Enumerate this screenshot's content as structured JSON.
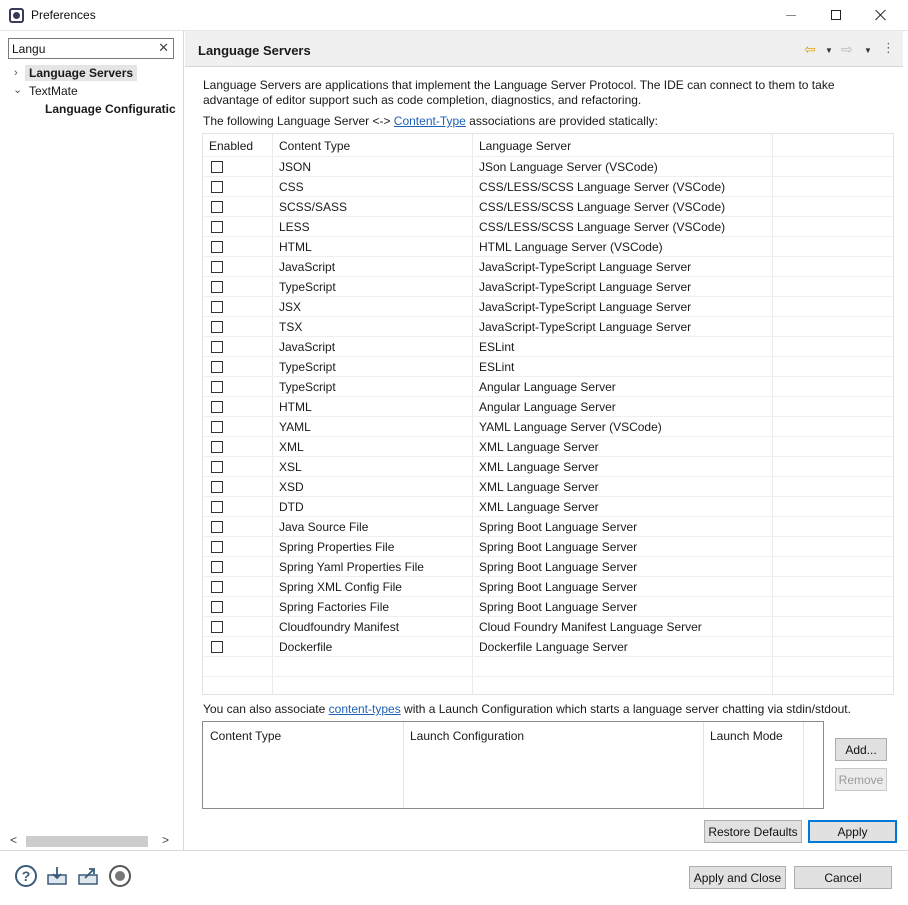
{
  "window": {
    "title": "Preferences",
    "minimize_label": "Minimize",
    "maximize_label": "Maximize",
    "close_label": "Close"
  },
  "sidebar": {
    "filter_value": "Langu",
    "clear_glyph": "✕",
    "tree": [
      {
        "label": "Language Servers",
        "expanded": false,
        "selected": true,
        "level": 0
      },
      {
        "label": "TextMate",
        "expanded": true,
        "selected": false,
        "level": 0
      },
      {
        "label": "Language Configuratic",
        "expanded": false,
        "selected": false,
        "level": 1
      }
    ],
    "arrows": {
      "collapsed": "›",
      "expanded": "⌄"
    },
    "scroll": {
      "left": "<",
      "right": ">"
    }
  },
  "page": {
    "title": "Language Servers",
    "nav": {
      "back": "⇦",
      "back_dd": "▼",
      "forward": "⇨",
      "forward_dd": "▼",
      "menu": "⋮"
    },
    "description_line1": "Language Servers are applications that implement the Language Server Protocol. The IDE can connect to them to take",
    "description_line2": "advantage of editor support such as code completion, diagnostics, and refactoring.",
    "static_prefix": "The following Language Server <-> ",
    "static_link": "Content-Type",
    "static_suffix": " associations are provided statically:",
    "columns": {
      "enabled": "Enabled",
      "content_type": "Content Type",
      "language_server": "Language Server"
    },
    "rows": [
      {
        "enabled": false,
        "content_type": "JSON",
        "server": "JSon Language Server (VSCode)"
      },
      {
        "enabled": false,
        "content_type": "CSS",
        "server": "CSS/LESS/SCSS Language Server (VSCode)"
      },
      {
        "enabled": false,
        "content_type": "SCSS/SASS",
        "server": "CSS/LESS/SCSS Language Server (VSCode)"
      },
      {
        "enabled": false,
        "content_type": "LESS",
        "server": "CSS/LESS/SCSS Language Server (VSCode)"
      },
      {
        "enabled": false,
        "content_type": "HTML",
        "server": "HTML Language Server (VSCode)"
      },
      {
        "enabled": false,
        "content_type": "JavaScript",
        "server": "JavaScript-TypeScript Language Server"
      },
      {
        "enabled": false,
        "content_type": "TypeScript",
        "server": "JavaScript-TypeScript Language Server"
      },
      {
        "enabled": false,
        "content_type": "JSX",
        "server": "JavaScript-TypeScript Language Server"
      },
      {
        "enabled": false,
        "content_type": "TSX",
        "server": "JavaScript-TypeScript Language Server"
      },
      {
        "enabled": false,
        "content_type": "JavaScript",
        "server": "ESLint"
      },
      {
        "enabled": false,
        "content_type": "TypeScript",
        "server": "ESLint"
      },
      {
        "enabled": false,
        "content_type": "TypeScript",
        "server": "Angular Language Server"
      },
      {
        "enabled": false,
        "content_type": "HTML",
        "server": "Angular Language Server"
      },
      {
        "enabled": false,
        "content_type": "YAML",
        "server": "YAML Language Server (VSCode)"
      },
      {
        "enabled": false,
        "content_type": "XML",
        "server": "XML Language Server"
      },
      {
        "enabled": false,
        "content_type": "XSL",
        "server": "XML Language Server"
      },
      {
        "enabled": false,
        "content_type": "XSD",
        "server": "XML Language Server"
      },
      {
        "enabled": false,
        "content_type": "DTD",
        "server": "XML Language Server"
      },
      {
        "enabled": false,
        "content_type": "Java Source File",
        "server": "Spring Boot Language Server"
      },
      {
        "enabled": false,
        "content_type": "Spring Properties File",
        "server": "Spring Boot Language Server"
      },
      {
        "enabled": false,
        "content_type": "Spring Yaml Properties File",
        "server": "Spring Boot Language Server"
      },
      {
        "enabled": false,
        "content_type": "Spring XML Config File",
        "server": "Spring Boot Language Server"
      },
      {
        "enabled": false,
        "content_type": "Spring Factories File",
        "server": "Spring Boot Language Server"
      },
      {
        "enabled": false,
        "content_type": "Cloudfoundry Manifest",
        "server": "Cloud Foundry Manifest Language Server"
      },
      {
        "enabled": false,
        "content_type": "Dockerfile",
        "server": "Dockerfile Language Server"
      }
    ],
    "launch_prefix": "You can also associate ",
    "launch_link": "content-types",
    "launch_suffix": " with a Launch Configuration which starts a language server chatting via stdin/stdout.",
    "launch_columns": {
      "content_type": "Content Type",
      "launch_configuration": "Launch Configuration",
      "launch_mode": "Launch Mode"
    },
    "add_label": "Add...",
    "remove_label": "Remove",
    "restore_label": "Restore Defaults",
    "apply_label": "Apply"
  },
  "footer": {
    "help_glyph": "?",
    "apply_close_label": "Apply and Close",
    "cancel_label": "Cancel"
  }
}
